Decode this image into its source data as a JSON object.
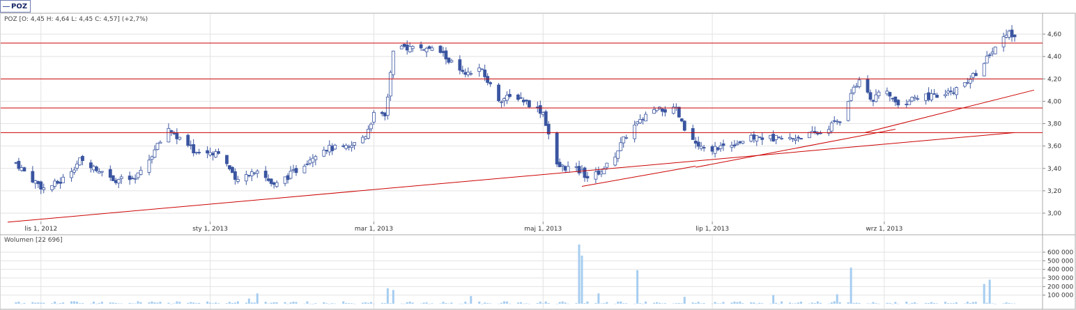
{
  "tab": {
    "label": "POZ"
  },
  "price_panel": {
    "ohlc_text": "POZ [O: 4,45  H: 4,64  L: 4,45  C: 4,57] (+2,7%)"
  },
  "volume_panel": {
    "label_text": "Wolumen [22 696]"
  },
  "colors": {
    "candle": "#3a55a0",
    "volume": "#a6cdf0",
    "support": "#cc0000",
    "grid": "#e2e2e2"
  },
  "chart_data": [
    {
      "type": "candlestick",
      "series_name": "POZ",
      "x_axis": {
        "ticks": [
          "lis 1, 2012",
          "sty 1, 2013",
          "mar 1, 2013",
          "maj 1, 2013",
          "lip 1, 2013",
          "wrz 1, 2013"
        ]
      },
      "y_axis": {
        "ticks": [
          "3,00",
          "3,20",
          "3,40",
          "3,60",
          "3,80",
          "4,00",
          "4,20",
          "4,40",
          "4,60"
        ],
        "ylim": [
          2.92,
          4.72
        ]
      },
      "grid": true,
      "last_bar": {
        "open": 4.45,
        "high": 4.64,
        "low": 4.45,
        "close": 4.57,
        "change_pct": 2.7
      },
      "horizontal_levels": [
        4.52,
        4.2,
        3.94,
        3.72
      ],
      "trendlines": [
        {
          "from": [
            "2012-10-20",
            2.92
          ],
          "to": [
            "2013-10-18",
            3.72
          ]
        },
        {
          "from": [
            "2013-05-15",
            3.24
          ],
          "to": [
            "2013-06-25",
            3.42
          ]
        },
        {
          "from": [
            "2013-06-25",
            3.41
          ],
          "to": [
            "2013-09-05",
            3.75
          ]
        },
        {
          "from": [
            "2013-08-25",
            3.72
          ],
          "to": [
            "2013-10-25",
            4.1
          ]
        }
      ],
      "close_path": [
        [
          "2012-10-23",
          3.45
        ],
        [
          "2012-10-28",
          3.32
        ],
        [
          "2012-11-02",
          3.22
        ],
        [
          "2012-11-08",
          3.28
        ],
        [
          "2012-11-15",
          3.47
        ],
        [
          "2012-11-20",
          3.42
        ],
        [
          "2012-11-28",
          3.3
        ],
        [
          "2012-12-05",
          3.3
        ],
        [
          "2012-12-12",
          3.56
        ],
        [
          "2012-12-17",
          3.76
        ],
        [
          "2012-12-20",
          3.68
        ],
        [
          "2012-12-27",
          3.54
        ],
        [
          "2013-01-05",
          3.55
        ],
        [
          "2013-01-10",
          3.28
        ],
        [
          "2013-01-18",
          3.4
        ],
        [
          "2013-01-24",
          3.24
        ],
        [
          "2013-02-02",
          3.4
        ],
        [
          "2013-02-10",
          3.58
        ],
        [
          "2013-02-20",
          3.58
        ],
        [
          "2013-02-26",
          3.7
        ],
        [
          "2013-03-01",
          3.88
        ],
        [
          "2013-03-05",
          3.86
        ],
        [
          "2013-03-08",
          4.42
        ],
        [
          "2013-03-12",
          4.48
        ],
        [
          "2013-03-18",
          4.48
        ],
        [
          "2013-03-25",
          4.44
        ],
        [
          "2013-04-03",
          4.22
        ],
        [
          "2013-04-08",
          4.3
        ],
        [
          "2013-04-15",
          4.02
        ],
        [
          "2013-04-22",
          4.04
        ],
        [
          "2013-05-01",
          3.9
        ],
        [
          "2013-05-06",
          3.42
        ],
        [
          "2013-05-12",
          3.4
        ],
        [
          "2013-05-18",
          3.32
        ],
        [
          "2013-05-25",
          3.44
        ],
        [
          "2013-06-01",
          3.74
        ],
        [
          "2013-06-10",
          3.92
        ],
        [
          "2013-06-18",
          3.92
        ],
        [
          "2013-06-22",
          3.68
        ],
        [
          "2013-06-28",
          3.56
        ],
        [
          "2013-07-08",
          3.62
        ],
        [
          "2013-07-17",
          3.68
        ],
        [
          "2013-07-28",
          3.66
        ],
        [
          "2013-08-09",
          3.72
        ],
        [
          "2013-08-16",
          3.84
        ],
        [
          "2013-08-23",
          4.2
        ],
        [
          "2013-08-28",
          4.0
        ],
        [
          "2013-09-01",
          4.12
        ],
        [
          "2013-09-06",
          3.96
        ],
        [
          "2013-09-13",
          4.04
        ],
        [
          "2013-09-22",
          4.04
        ],
        [
          "2013-10-01",
          4.16
        ],
        [
          "2013-10-06",
          4.32
        ],
        [
          "2013-10-11",
          4.48
        ],
        [
          "2013-10-15",
          4.62
        ],
        [
          "2013-10-18",
          4.57
        ]
      ],
      "date_range": [
        "2012-10-20",
        "2013-10-18"
      ]
    },
    {
      "type": "bar",
      "series_name": "Wolumen",
      "y_axis": {
        "ticks": [
          "100 000",
          "200 000",
          "300 000",
          "400 000",
          "500 000",
          "600 000"
        ],
        "ylim": [
          0,
          700000
        ]
      },
      "last_value": 22696,
      "spikes": [
        [
          "2012-11-20",
          25000
        ],
        [
          "2013-01-15",
          60000
        ],
        [
          "2013-01-18",
          120000
        ],
        [
          "2013-03-06",
          180000
        ],
        [
          "2013-03-08",
          160000
        ],
        [
          "2013-04-05",
          90000
        ],
        [
          "2013-05-14",
          690000
        ],
        [
          "2013-05-15",
          560000
        ],
        [
          "2013-05-19",
          170000
        ],
        [
          "2013-05-21",
          120000
        ],
        [
          "2013-06-04",
          390000
        ],
        [
          "2013-06-21",
          80000
        ],
        [
          "2013-07-14",
          160000
        ],
        [
          "2013-07-23",
          100000
        ],
        [
          "2013-08-15",
          110000
        ],
        [
          "2013-08-20",
          420000
        ],
        [
          "2013-09-01",
          60000
        ],
        [
          "2013-10-07",
          230000
        ],
        [
          "2013-10-09",
          280000
        ]
      ],
      "base_level": 22000
    }
  ]
}
